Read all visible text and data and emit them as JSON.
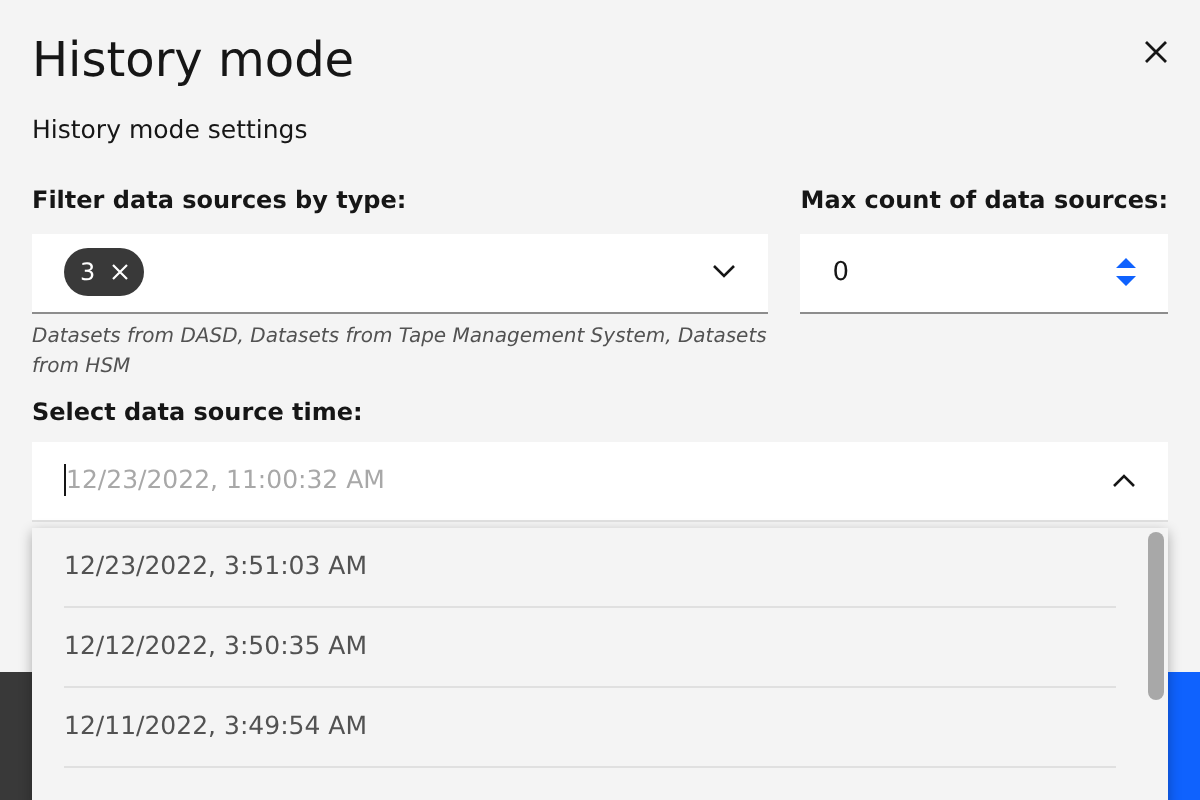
{
  "modal": {
    "title": "History mode",
    "subtitle": "History mode settings"
  },
  "filter": {
    "label": "Filter data sources by type:",
    "tag": "3",
    "helper": "Datasets from DASD, Datasets from Tape Management System, Datasets from HSM"
  },
  "max_count": {
    "label": "Max count of data sources:",
    "value": "0"
  },
  "time": {
    "label": "Select data source time:",
    "placeholder": "12/23/2022, 11:00:32 AM",
    "expanded": true,
    "options": [
      "12/23/2022, 3:51:03 AM",
      "12/12/2022, 3:50:35 AM",
      "12/11/2022, 3:49:54 AM"
    ]
  }
}
